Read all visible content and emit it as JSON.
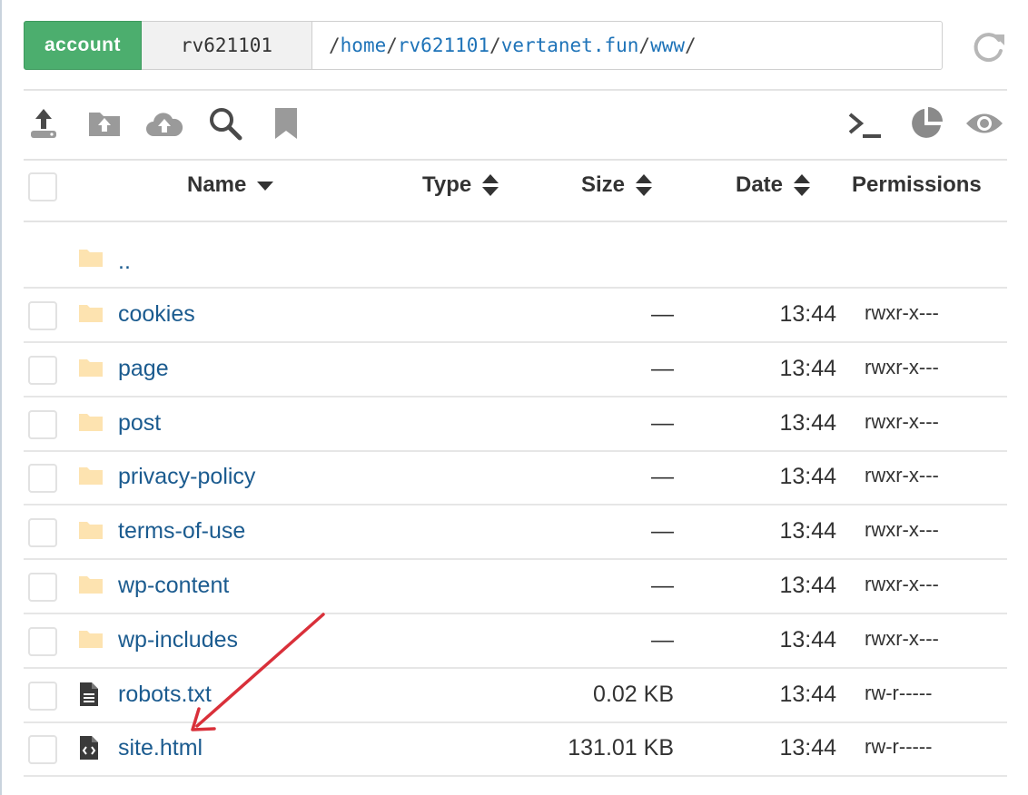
{
  "pathbar": {
    "account_label": "account",
    "account_name": "rv621101",
    "segments": [
      "home",
      "rv621101",
      "vertanet.fun",
      "www"
    ]
  },
  "toolbar": {
    "left_icons": [
      "upload-icon",
      "upload-folder-icon",
      "cloud-upload-icon",
      "search-icon",
      "bookmark-icon"
    ],
    "right_icons": [
      "terminal-icon",
      "pie-chart-icon",
      "eye-icon"
    ],
    "refresh_icon": "refresh-icon"
  },
  "table": {
    "columns": {
      "name": "Name",
      "type": "Type",
      "size": "Size",
      "date": "Date",
      "permissions": "Permissions"
    },
    "parent_label": "..",
    "rows": [
      {
        "name": "cookies",
        "kind": "folder",
        "size": "—",
        "date": "13:44",
        "perm": "rwxr-x---"
      },
      {
        "name": "page",
        "kind": "folder",
        "size": "—",
        "date": "13:44",
        "perm": "rwxr-x---"
      },
      {
        "name": "post",
        "kind": "folder",
        "size": "—",
        "date": "13:44",
        "perm": "rwxr-x---"
      },
      {
        "name": "privacy-policy",
        "kind": "folder",
        "size": "—",
        "date": "13:44",
        "perm": "rwxr-x---"
      },
      {
        "name": "terms-of-use",
        "kind": "folder",
        "size": "—",
        "date": "13:44",
        "perm": "rwxr-x---"
      },
      {
        "name": "wp-content",
        "kind": "folder",
        "size": "—",
        "date": "13:44",
        "perm": "rwxr-x---"
      },
      {
        "name": "wp-includes",
        "kind": "folder",
        "size": "—",
        "date": "13:44",
        "perm": "rwxr-x---"
      },
      {
        "name": "robots.txt",
        "kind": "text-file",
        "size": "0.02 KB",
        "date": "13:44",
        "perm": "rw-r-----"
      },
      {
        "name": "site.html",
        "kind": "code-file",
        "size": "131.01 KB",
        "date": "13:44",
        "perm": "rw-r-----"
      }
    ]
  },
  "colors": {
    "accent_green": "#4cae6e",
    "link_blue": "#1b5b8f",
    "folder_yellow": "#fde3b0",
    "annotation_red": "#d9303a"
  }
}
